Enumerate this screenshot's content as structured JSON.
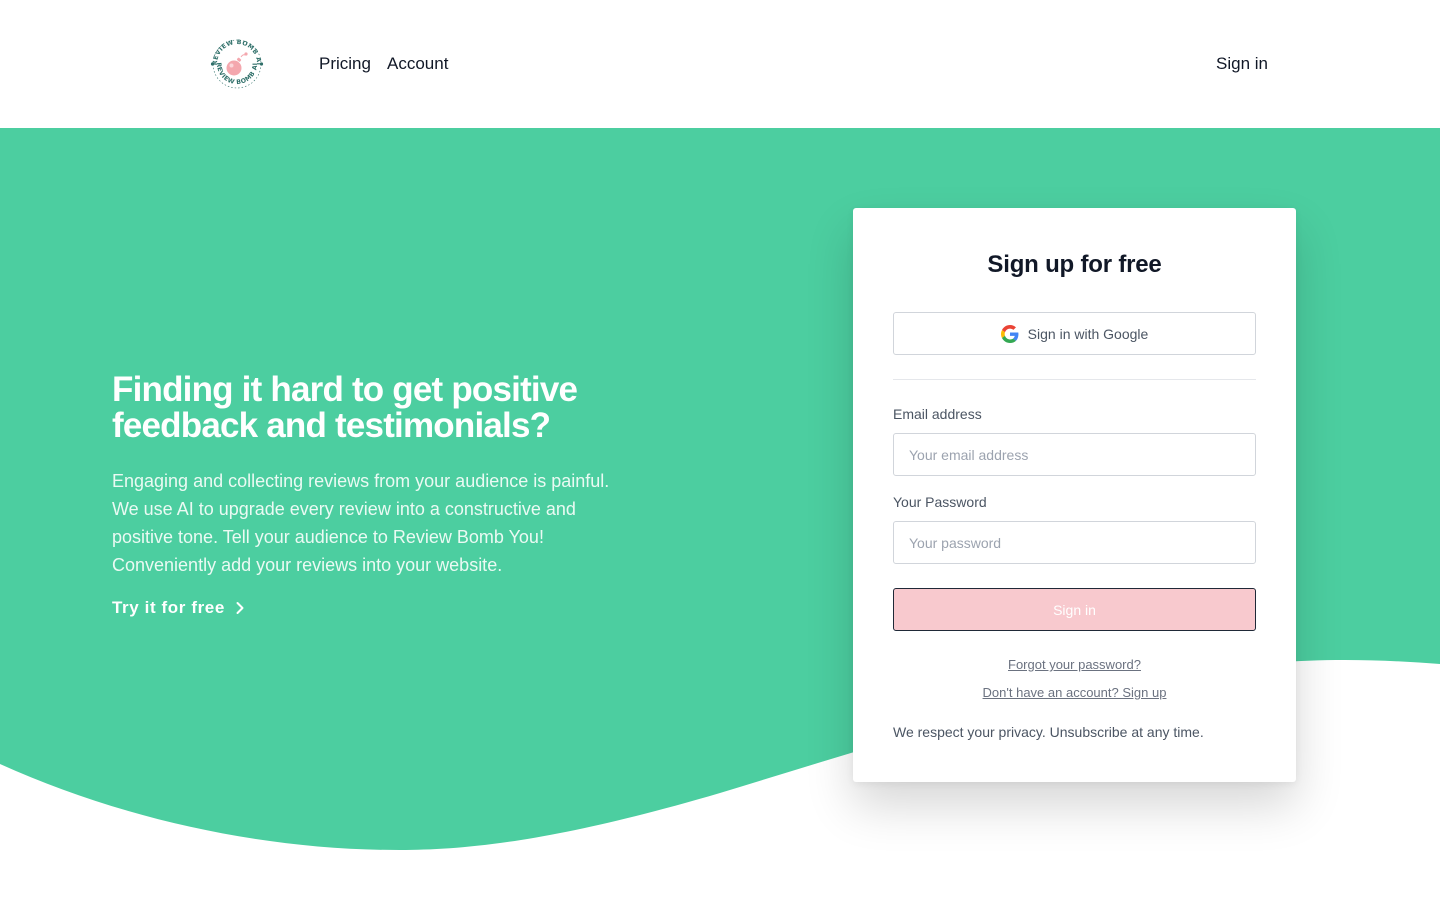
{
  "header": {
    "logo_text": "REVIEW BOMB AI",
    "nav": [
      {
        "label": "Pricing"
      },
      {
        "label": "Account"
      }
    ],
    "signin_label": "Sign in"
  },
  "hero": {
    "headline": "Finding it hard to get positive feedback and testimonials?",
    "description": "Engaging and collecting reviews from your audience is painful. We use AI to upgrade every review into a constructive and positive tone. Tell your audience to Review Bomb You! Conveniently add your reviews into your website.",
    "cta_label": "Try it for free",
    "cta_icon": "chevron-right-icon"
  },
  "form": {
    "title": "Sign up for free",
    "google_label": "Sign in with Google",
    "email_label": "Email address",
    "email_placeholder": "Your email address",
    "email_value": "",
    "password_label": "Your Password",
    "password_placeholder": "Your password",
    "password_value": "",
    "submit_label": "Sign in",
    "forgot_label": "Forgot your password?",
    "signup_label": "Don't have an account? Sign up",
    "privacy_text": "We respect your privacy. Unsubscribe at any time."
  },
  "colors": {
    "brand_green": "#4ccea0",
    "button_pink": "#f8c9ce",
    "logo_pink": "#f4a7ae",
    "logo_teal": "#2f6f69"
  }
}
